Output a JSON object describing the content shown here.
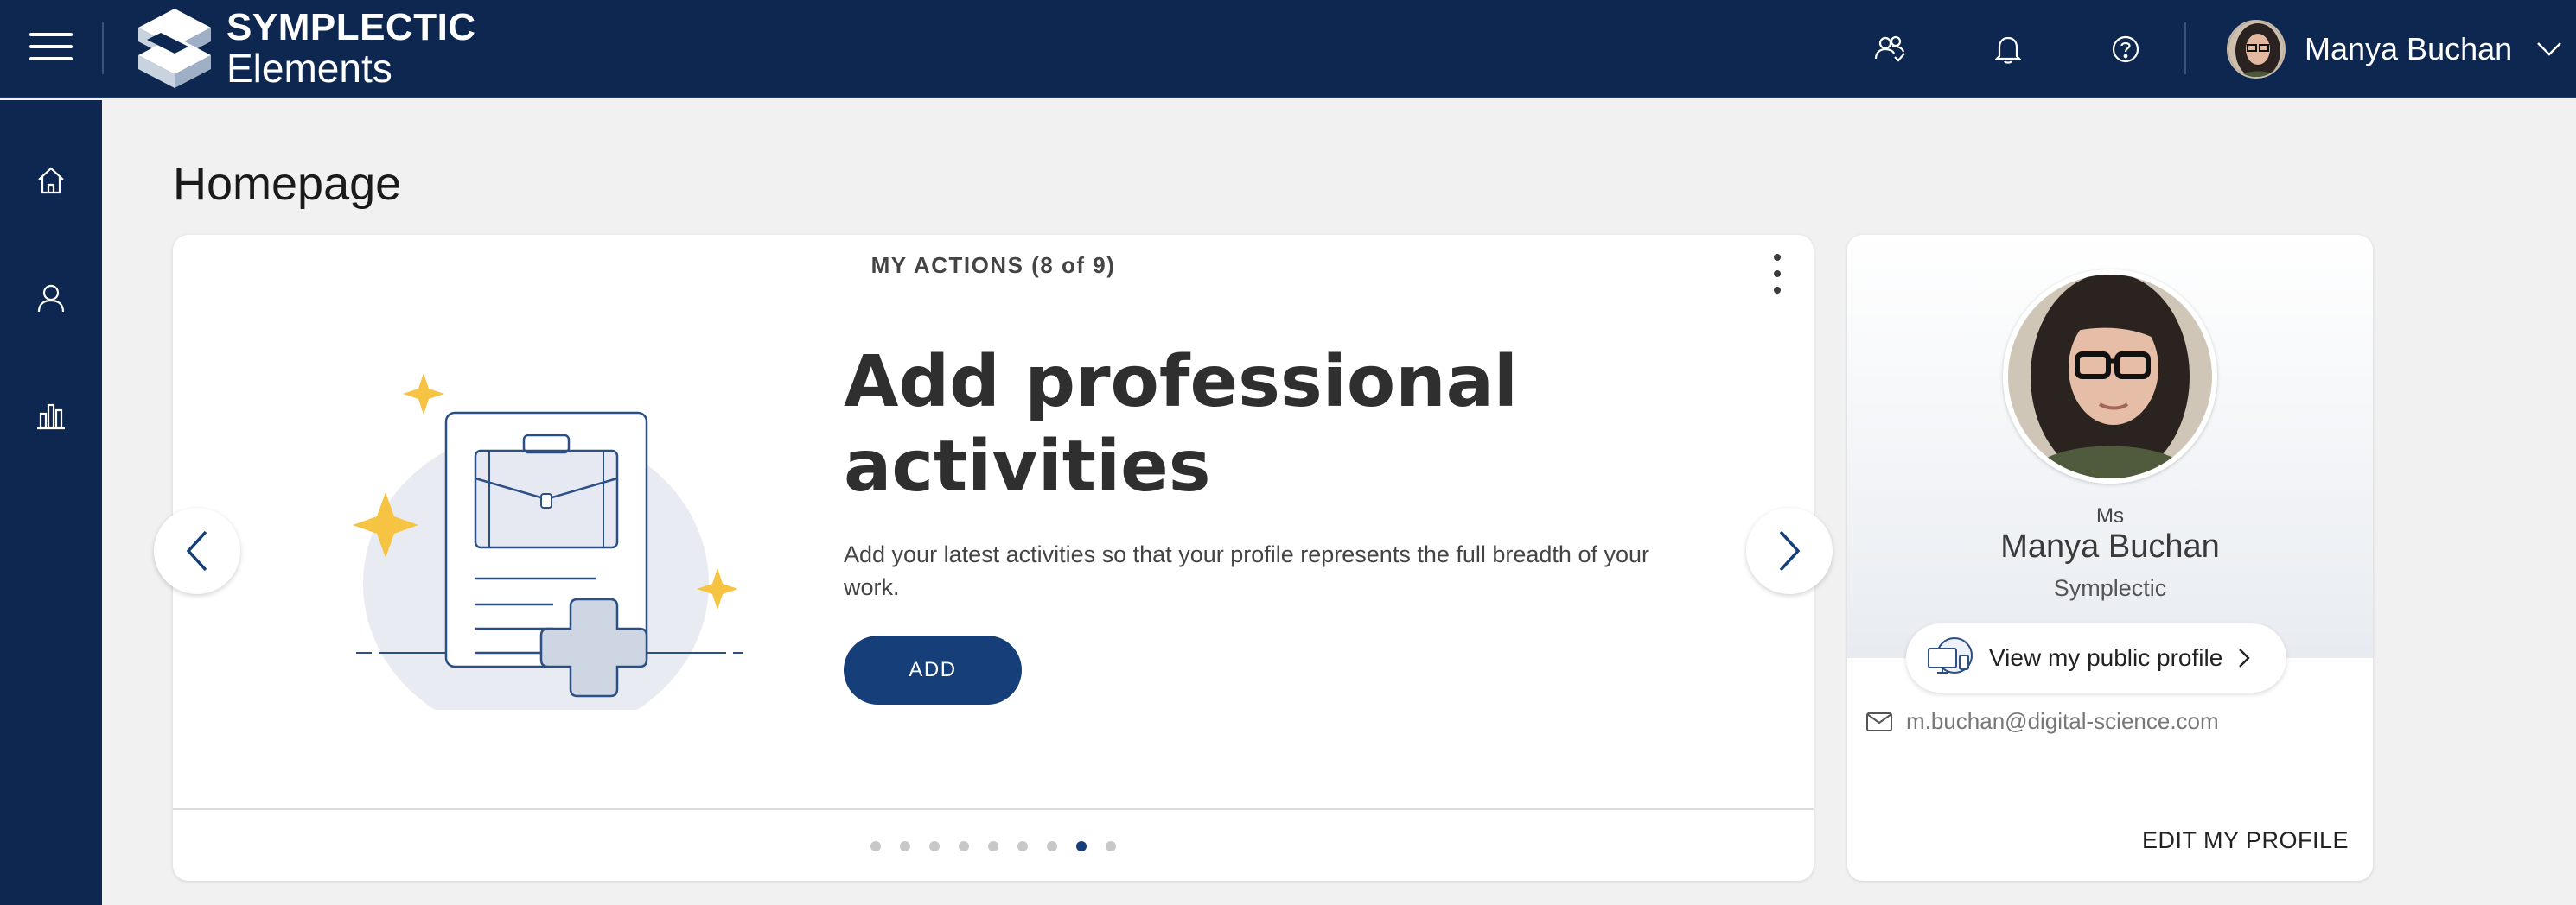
{
  "header": {
    "logo_line1": "SYMPLECTIC",
    "logo_line2": "Elements",
    "icons": [
      "delegates-icon",
      "bell-icon",
      "help-icon"
    ],
    "user_name": "Manya Buchan"
  },
  "sidebar": {
    "items": [
      {
        "icon": "home-icon"
      },
      {
        "icon": "user-icon"
      },
      {
        "icon": "bar-chart-icon"
      }
    ]
  },
  "page": {
    "title": "Homepage"
  },
  "actions": {
    "header": "MY ACTIONS (8 of 9)",
    "title_line1": "Add professional",
    "title_line2": "activities",
    "description": "Add your latest activities so that your profile represents the full breadth of your work.",
    "button_label": "ADD",
    "total_steps": 9,
    "current_step": 8
  },
  "profile": {
    "salutation": "Ms",
    "name": "Manya Buchan",
    "organization": "Symplectic",
    "public_profile_label": "View my public profile",
    "email": "m.buchan@digital-science.com",
    "edit_label": "EDIT MY PROFILE"
  },
  "colors": {
    "navy": "#0d2750",
    "button": "#163e78",
    "star": "#f6c343",
    "background": "#f1f1f1"
  }
}
